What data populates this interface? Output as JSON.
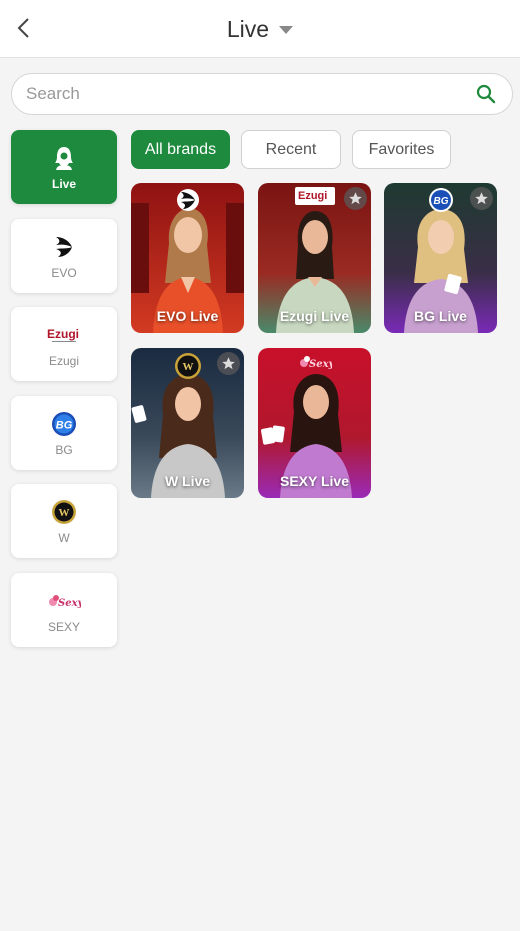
{
  "header": {
    "title": "Live",
    "back_icon": "chevron-left-icon",
    "dropdown_icon": "caret-down-icon"
  },
  "search": {
    "placeholder": "Search",
    "value": "",
    "icon": "search-icon"
  },
  "sidebar": {
    "items": [
      {
        "label": "Live",
        "icon": "live-dealer-icon",
        "active": true
      },
      {
        "label": "EVO",
        "icon": "evo-logo"
      },
      {
        "label": "Ezugi",
        "icon": "ezugi-logo",
        "logo_text": "Ezugi"
      },
      {
        "label": "BG",
        "icon": "bg-logo",
        "logo_text": "BG"
      },
      {
        "label": "W",
        "icon": "w-logo",
        "logo_text": "W"
      },
      {
        "label": "SEXY",
        "icon": "sexy-logo",
        "logo_text": "Sexy"
      }
    ]
  },
  "tabs": [
    {
      "label": "All brands",
      "active": true
    },
    {
      "label": "Recent"
    },
    {
      "label": "Favorites"
    }
  ],
  "games": [
    {
      "label": "EVO Live",
      "logo": "evo-logo",
      "favorite_icon": false
    },
    {
      "label": "Ezugi Live",
      "logo": "ezugi-logo",
      "logo_text": "Ezugi",
      "favorite_icon": true
    },
    {
      "label": "BG Live",
      "logo": "bg-logo",
      "logo_text": "BG",
      "favorite_icon": true
    },
    {
      "label": "W Live",
      "logo": "w-logo",
      "logo_text": "W",
      "favorite_icon": true
    },
    {
      "label": "SEXY Live",
      "logo": "sexy-logo",
      "logo_text": "Sexy",
      "favorite_icon": false
    }
  ],
  "colors": {
    "accent": "#1d8a3e",
    "background": "#f4f4f4",
    "search_icon": "#1d8a3e"
  }
}
